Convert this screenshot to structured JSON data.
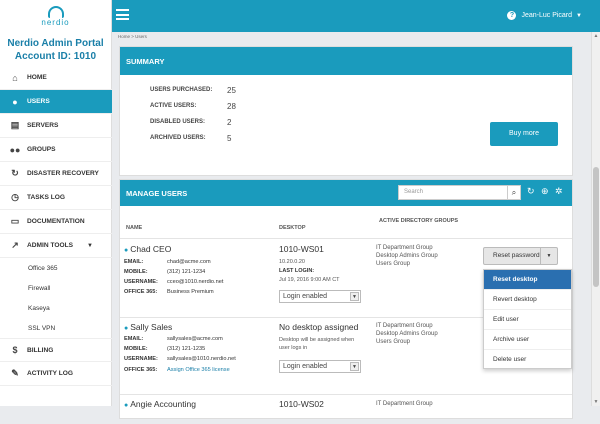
{
  "brand": {
    "logo_text": "nerdio",
    "portal_title": "Nerdio Admin Portal",
    "account_id": "Account ID: 1010"
  },
  "nav": [
    {
      "label": "HOME",
      "icon": "home-icon",
      "glyph": "⌂"
    },
    {
      "label": "USERS",
      "icon": "user-icon",
      "glyph": "👤"
    },
    {
      "label": "SERVERS",
      "icon": "server-icon",
      "glyph": "▤"
    },
    {
      "label": "GROUPS",
      "icon": "group-icon",
      "glyph": "👥"
    },
    {
      "label": "DISASTER RECOVERY",
      "icon": "refresh-icon",
      "glyph": "↻"
    },
    {
      "label": "TASKS LOG",
      "icon": "clock-icon",
      "glyph": "◷"
    },
    {
      "label": "DOCUMENTATION",
      "icon": "book-icon",
      "glyph": "▭"
    },
    {
      "label": "ADMIN TOOLS",
      "icon": "external-link-icon",
      "glyph": "↗"
    }
  ],
  "admin_tools_sub": [
    "Office 365",
    "Firewall",
    "Kaseya",
    "SSL VPN"
  ],
  "nav_bottom": [
    {
      "label": "BILLING",
      "icon": "dollar-icon",
      "glyph": "$"
    },
    {
      "label": "ACTIVITY LOG",
      "icon": "wrench-icon",
      "glyph": "✎"
    }
  ],
  "topbar": {
    "user_name": "Jean-Luc Picard",
    "help_glyph": "?"
  },
  "breadcrumb": "Home > Users",
  "summary": {
    "title": "SUMMARY",
    "rows": [
      {
        "label": "USERS PURCHASED:",
        "value": "25"
      },
      {
        "label": "ACTIVE USERS:",
        "value": "28"
      },
      {
        "label": "DISABLED USERS:",
        "value": "2"
      },
      {
        "label": "ARCHIVED USERS:",
        "value": "5"
      }
    ],
    "buy_more": "Buy more"
  },
  "manage": {
    "title": "MANAGE USERS",
    "search_placeholder": "Search",
    "col_name": "NAME",
    "col_desktop": "DESKTOP",
    "col_groups": "ACTIVE DIRECTORY GROUPS"
  },
  "users": [
    {
      "name": "Chad CEO",
      "email": "chad@acme.com",
      "mobile": "(312) 121-1234",
      "username": "cceo@1010.nerdio.net",
      "office365": "Business Premium",
      "desktop": "1010-WS01",
      "ip": "10.20.0.20",
      "last_login_label": "LAST LOGIN:",
      "last_login": "Jul 19, 2016 9:00 AM CT",
      "login_state": "Login enabled",
      "groups": [
        "IT Department Group",
        "Desktop Admins Group",
        "Users Group"
      ]
    },
    {
      "name": "Sally Sales",
      "email": "sallysales@acme.com",
      "mobile": "(312) 121-1235",
      "username": "sallysales@1010.nerdio.net",
      "office365": "Assign Office 365 license",
      "desktop": "No desktop assigned",
      "desktop_note": "Desktop will be assigned when user logs in",
      "login_state": "Login enabled",
      "groups": [
        "IT Department Group",
        "Desktop Admins Group",
        "Users Group"
      ]
    },
    {
      "name": "Angie Accounting",
      "desktop": "1010-WS02",
      "groups": [
        "IT Department Group"
      ]
    }
  ],
  "labels": {
    "email": "EMAIL:",
    "mobile": "MOBILE:",
    "username": "USERNAME:",
    "office365": "OFFICE 365:"
  },
  "actions": {
    "reset_password": "Reset password",
    "menu": [
      "Reset desktop",
      "Revert desktop",
      "Edit user",
      "Archive user",
      "Delete user"
    ]
  },
  "colors": {
    "accent": "#1a9bbd",
    "menu_active": "#2a6fb0"
  }
}
